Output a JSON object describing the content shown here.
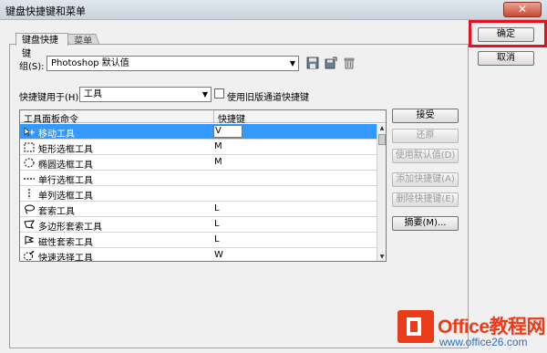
{
  "window": {
    "title": "键盘快捷键和菜单",
    "close_label": "✕"
  },
  "tabs": [
    {
      "label": "键盘快捷键"
    },
    {
      "label": "菜单"
    }
  ],
  "set": {
    "label": "组(S):",
    "value": "Photoshop 默认值"
  },
  "shortcuts_for": {
    "label": "快捷键用于(H):",
    "value": "工具"
  },
  "legacy_checkbox": {
    "label": "使用旧版通道快捷键",
    "checked": false
  },
  "list": {
    "col_command": "工具面板命令",
    "col_shortcut": "快捷键",
    "rows": [
      {
        "name": "移动工具",
        "key": "V",
        "icon": "move-tool-icon",
        "selected": true
      },
      {
        "name": "矩形选框工具",
        "key": "M",
        "icon": "rect-marquee-icon",
        "selected": false
      },
      {
        "name": "椭圆选框工具",
        "key": "M",
        "icon": "ellipse-marquee-icon",
        "selected": false
      },
      {
        "name": "单行选框工具",
        "key": "",
        "icon": "single-row-marquee-icon",
        "selected": false
      },
      {
        "name": "单列选框工具",
        "key": "",
        "icon": "single-column-marquee-icon",
        "selected": false
      },
      {
        "name": "套索工具",
        "key": "L",
        "icon": "lasso-icon",
        "selected": false
      },
      {
        "name": "多边形套索工具",
        "key": "L",
        "icon": "polygon-lasso-icon",
        "selected": false
      },
      {
        "name": "磁性套索工具",
        "key": "L",
        "icon": "magnetic-lasso-icon",
        "selected": false
      },
      {
        "name": "快速选择工具",
        "key": "W",
        "icon": "quick-selection-icon",
        "selected": false
      }
    ]
  },
  "side_buttons": {
    "accept": "接受",
    "undo": "还原",
    "use_default": "使用默认值(D)",
    "add_shortcut": "添加快捷键(A)",
    "delete_shortcut": "删除快捷键(E)",
    "summarize": "摘要(M)..."
  },
  "dialog_buttons": {
    "ok": "确定",
    "cancel": "取消"
  },
  "watermark": {
    "brand": "Office教程网",
    "url": "www.office26.com"
  },
  "colors": {
    "selection": "#3399ff",
    "highlight": "#e8101a",
    "brand": "#ea3c1a"
  }
}
